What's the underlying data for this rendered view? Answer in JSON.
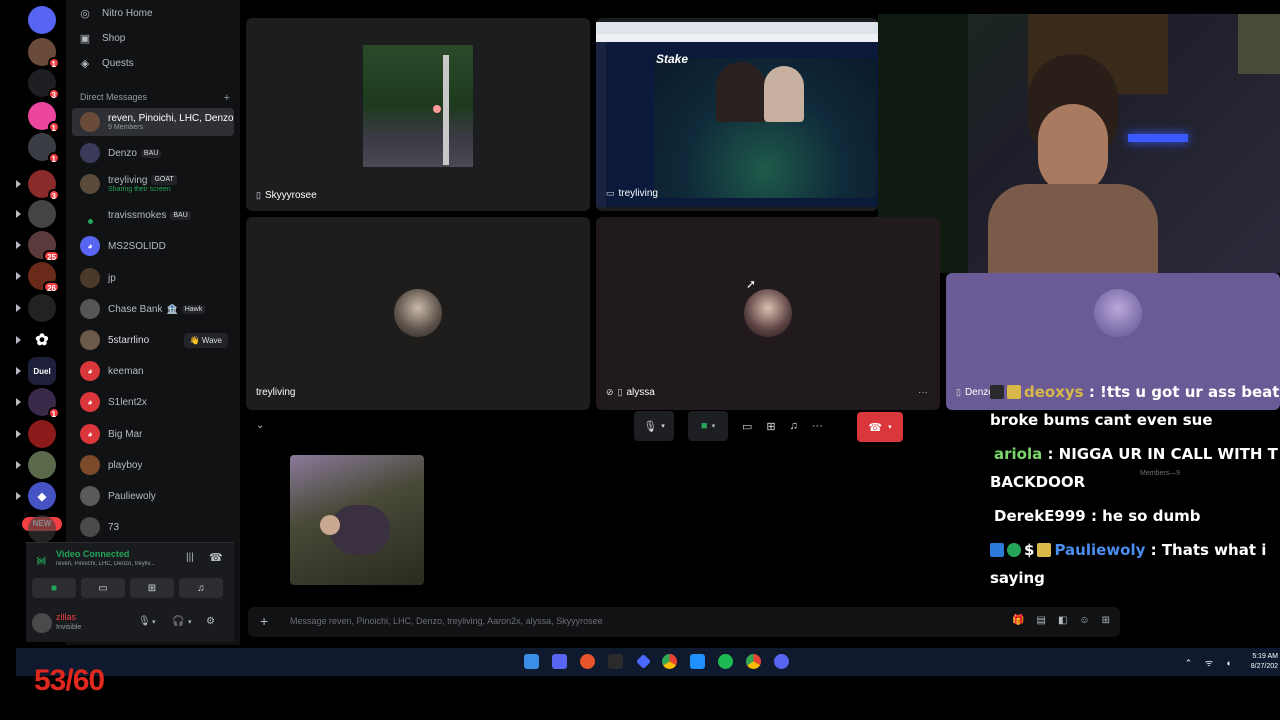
{
  "nav": {
    "nitro_home": "Nitro Home",
    "shop": "Shop",
    "quests": "Quests"
  },
  "direct_messages": {
    "header": "Direct Messages",
    "add": "+",
    "items": [
      {
        "name": "reven, Pinoichi, LHC, Denzo...",
        "sub": "9 Members"
      },
      {
        "name": "Denzo",
        "tag": "BAU"
      },
      {
        "name": "treyliving",
        "tag": "GOAT",
        "sub": "Sharing their screen"
      },
      {
        "name": "travissmokes",
        "tag": "BAU"
      },
      {
        "name": "MS2SOLIDD"
      },
      {
        "name": "jp"
      },
      {
        "name": "Chase Bank",
        "tag": "Hawk"
      },
      {
        "name": "5starrlino",
        "action": "Wave"
      },
      {
        "name": "keeman"
      },
      {
        "name": "S1lent2x"
      },
      {
        "name": "Big Mar"
      },
      {
        "name": "playboy"
      },
      {
        "name": "Pauliewoly"
      },
      {
        "name": "73"
      }
    ]
  },
  "server_rail": {
    "badges": [
      "1",
      "3",
      "1",
      "1",
      "3",
      "1",
      "25",
      "26",
      "1"
    ],
    "duel": "Duel",
    "new": "NEW"
  },
  "voice": {
    "status": "Video Connected",
    "channel": "reven, Pinoichi, LHC, Denzo, treyliv..."
  },
  "user": {
    "name": "zillas",
    "status": "Invisible"
  },
  "tiles": {
    "skyyyrosee": "Skyyyrosee",
    "treyliving_screen": "treyliving",
    "treyliving_cam": "treyliving",
    "alyssa": "alyssa",
    "denzo": "Denzo",
    "stake_logo": "Stake"
  },
  "message_bar": {
    "placeholder": "Message reven, Pinoichi, LHC, Denzo, treyliving, Aaron2x, alyssa, Skyyyrosee"
  },
  "chat": [
    {
      "user": "deoxys",
      "text": " : !tts u got ur ass beat"
    },
    {
      "user": "",
      "text": "broke bums cant even sue"
    },
    {
      "user": "ariola",
      "text": " : NIGGA UR IN CALL WITH T"
    },
    {
      "user": "",
      "text": "BACKDOOR"
    },
    {
      "user": "DerekE999",
      "text": " : he so dumb"
    },
    {
      "user": "Pauliewoly",
      "text": " : Thats what i"
    },
    {
      "user": "",
      "text": "saying"
    }
  ],
  "members_ghost": "Members—9",
  "taskbar": {
    "time": "5:19 AM",
    "date": "8/27/202"
  },
  "counter": "53/60",
  "colors": {
    "accent_green": "#23a55a",
    "hangup_red": "#da373c",
    "counter_red": "#e0281e",
    "chat_blue": "#4a8ff0",
    "chat_gold": "#d8b84a",
    "chat_green": "#7bd66b"
  }
}
